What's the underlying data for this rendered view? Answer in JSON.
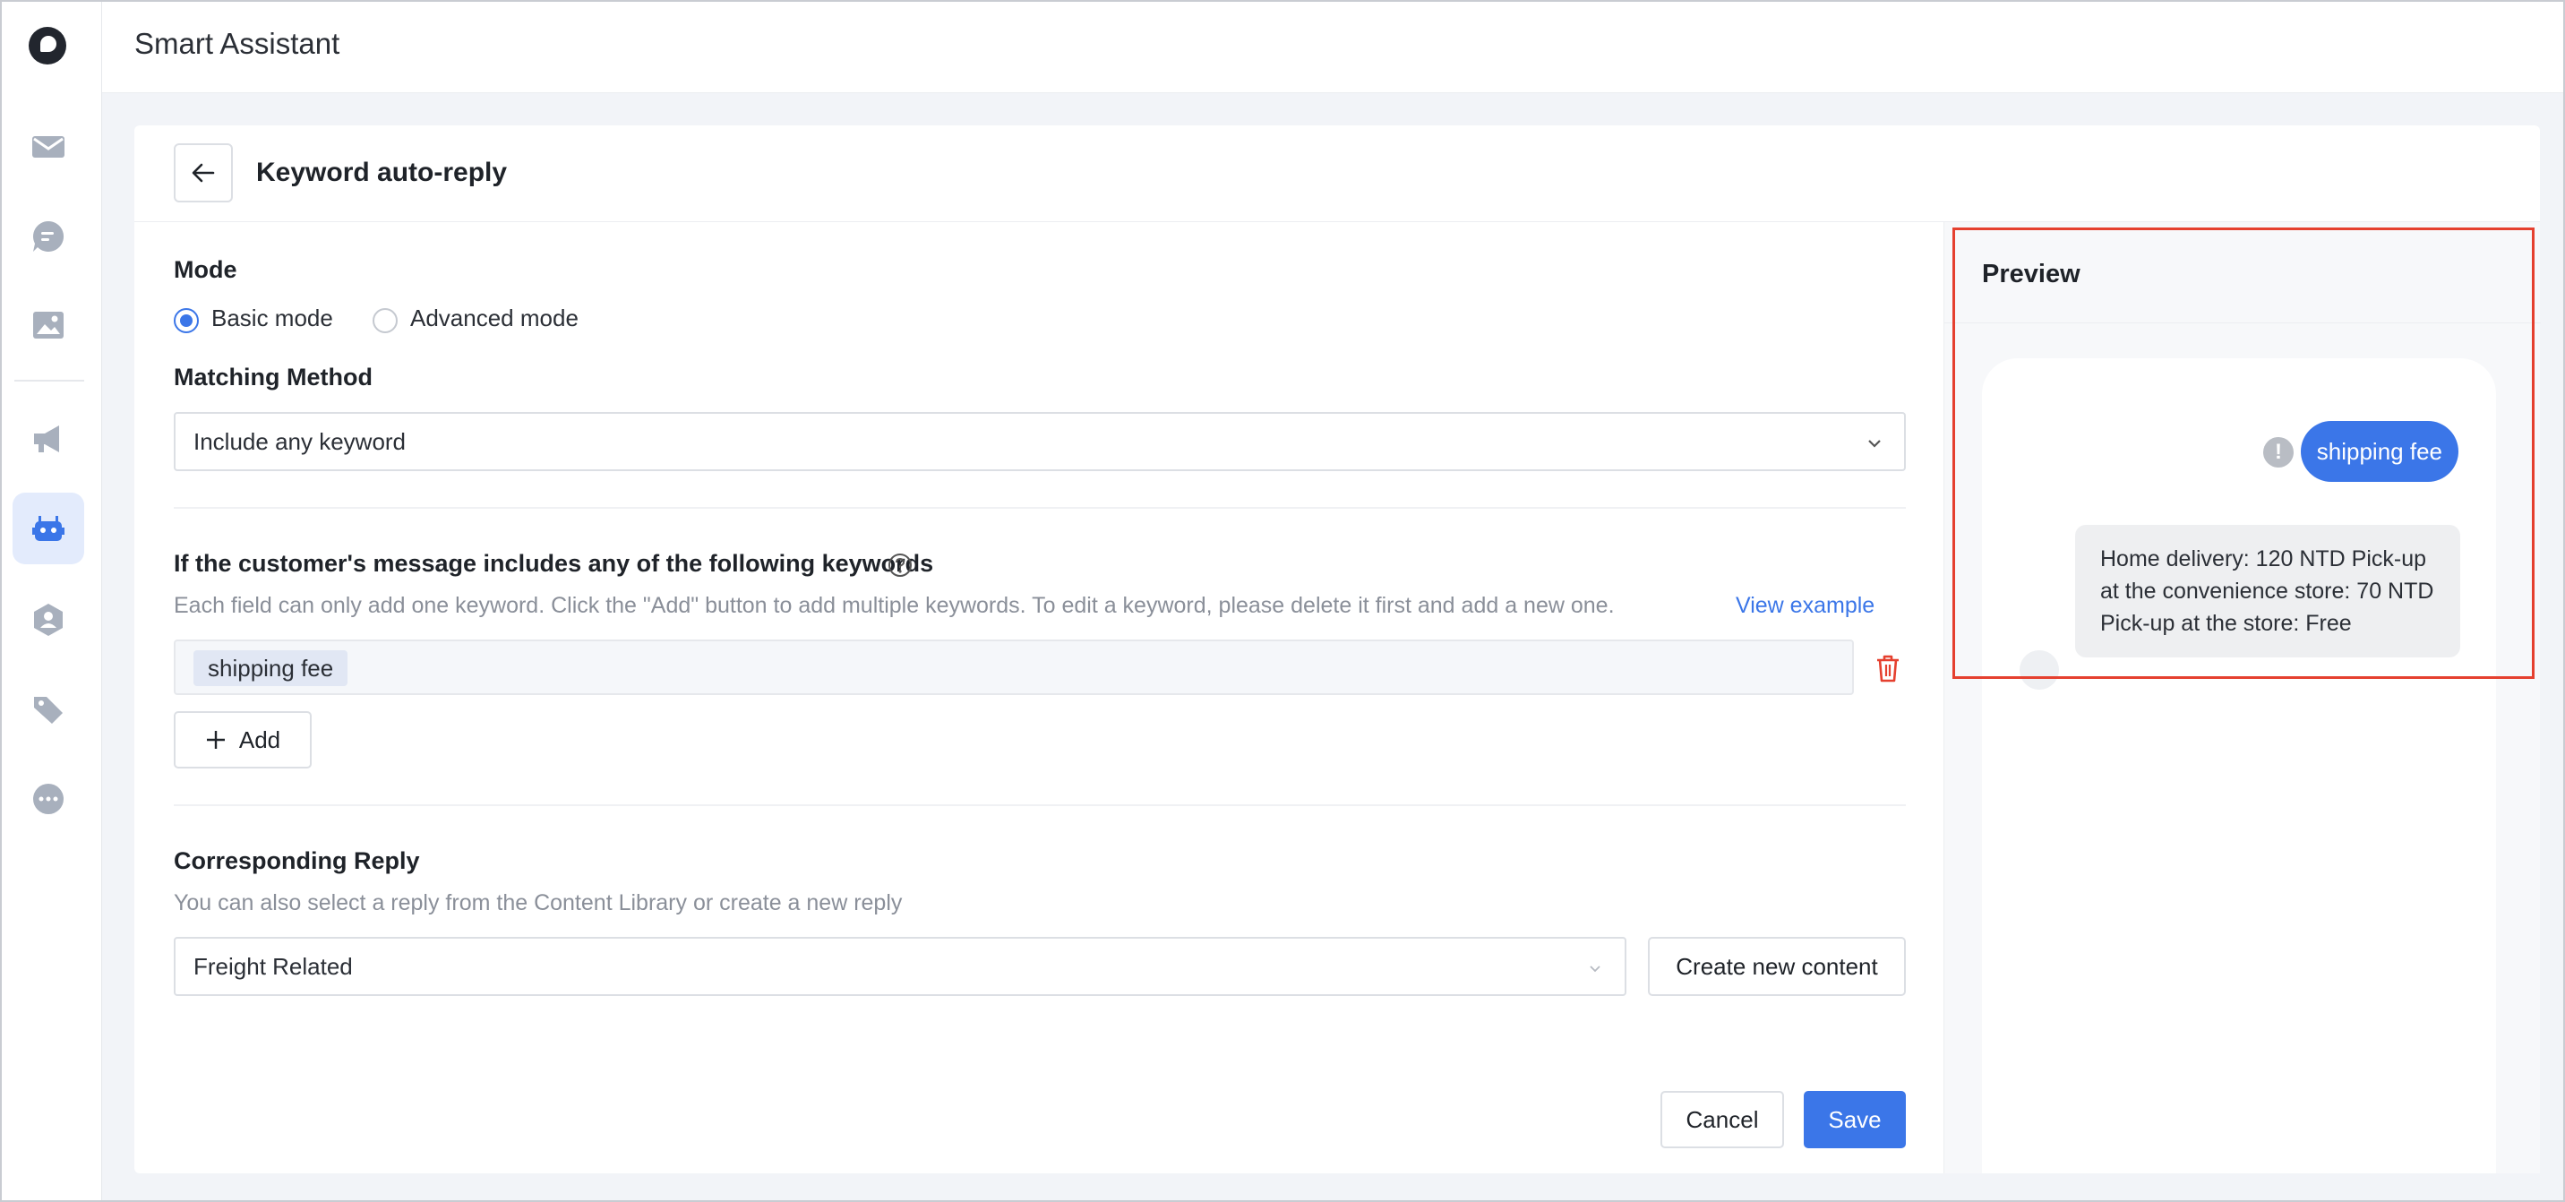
{
  "app": {
    "title": "Smart Assistant"
  },
  "sidebar": {
    "items": [
      {
        "icon": "inbox-icon"
      },
      {
        "icon": "chat-icon"
      },
      {
        "icon": "image-library-icon"
      },
      {
        "icon": "broadcast-icon"
      },
      {
        "icon": "bot-icon",
        "active": true
      },
      {
        "icon": "customer-icon"
      },
      {
        "icon": "tag-icon"
      },
      {
        "icon": "more-icon"
      }
    ]
  },
  "page": {
    "title": "Keyword auto-reply",
    "back_icon": "arrow-left-icon"
  },
  "form": {
    "mode": {
      "label": "Mode",
      "options": [
        {
          "label": "Basic mode",
          "checked": true
        },
        {
          "label": "Advanced mode",
          "checked": false
        }
      ]
    },
    "matching": {
      "label": "Matching Method",
      "value": "Include any keyword"
    },
    "keywords": {
      "label": "If the customer's message includes any of the following keywords",
      "hint": "Each field can only add one keyword. Click the \"Add\" button to add multiple keywords. To edit a keyword, please delete it first and add a new one.",
      "example_link": "View example",
      "tags": [
        "shipping fee"
      ],
      "add_label": "Add"
    },
    "reply": {
      "label": "Corresponding Reply",
      "hint": "You can also select a reply from the Content Library or create a new reply",
      "value": "Freight Related",
      "create_label": "Create new content"
    },
    "actions": {
      "cancel": "Cancel",
      "save": "Save"
    }
  },
  "preview": {
    "title": "Preview",
    "user_message": "shipping fee",
    "bot_reply": "Home delivery: 120 NTD Pick-up at the convenience store: 70 NTD Pick-up at the store: Free"
  },
  "colors": {
    "accent": "#3b76e8",
    "danger": "#e5402f",
    "rail_icon": "#a8b0bd",
    "rail_icon_active": "#3b76e8"
  }
}
